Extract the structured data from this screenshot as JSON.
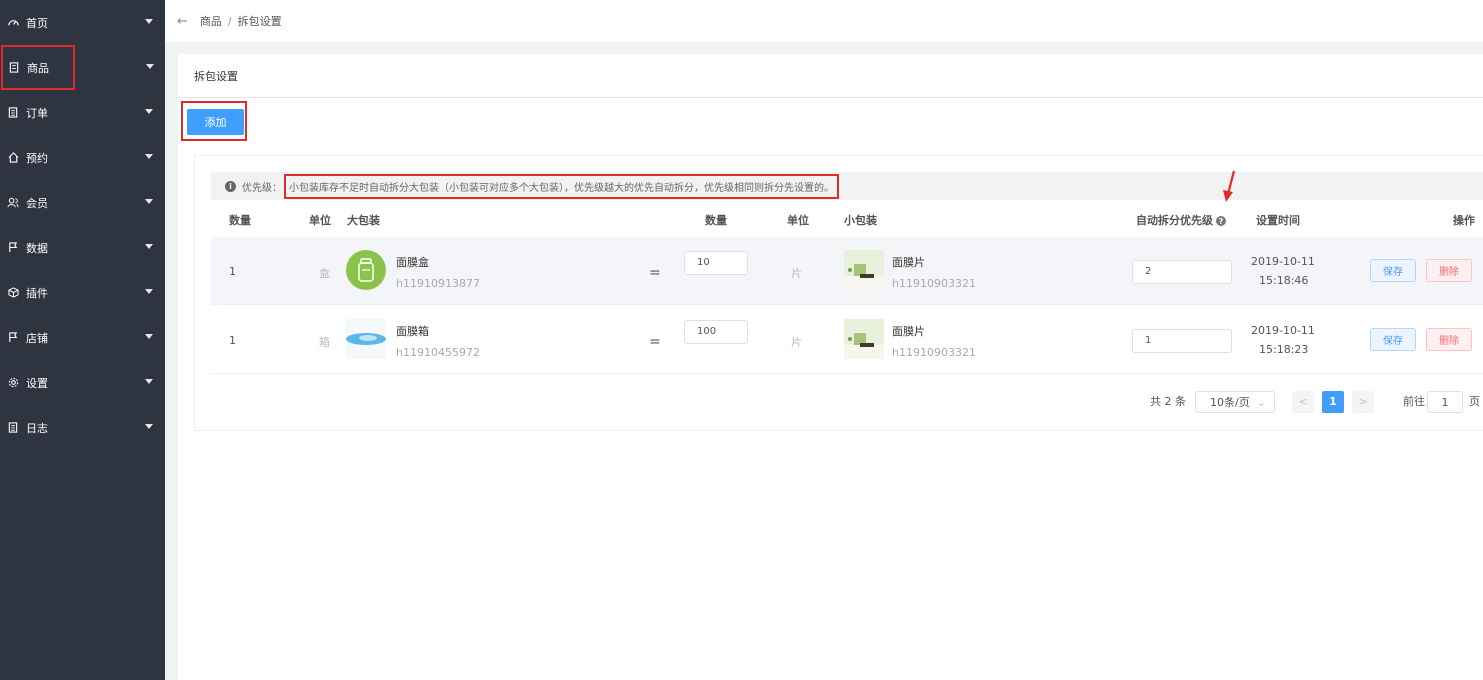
{
  "sidebar": {
    "items": [
      {
        "label": "首页",
        "icon": "dashboard-icon"
      },
      {
        "label": "商品",
        "icon": "document-icon"
      },
      {
        "label": "订单",
        "icon": "list-icon"
      },
      {
        "label": "预约",
        "icon": "home-icon"
      },
      {
        "label": "会员",
        "icon": "users-icon"
      },
      {
        "label": "数据",
        "icon": "flag-icon"
      },
      {
        "label": "插件",
        "icon": "cube-icon"
      },
      {
        "label": "店铺",
        "icon": "flag-icon"
      },
      {
        "label": "设置",
        "icon": "gear-icon"
      },
      {
        "label": "日志",
        "icon": "list-icon"
      }
    ]
  },
  "breadcrumb": {
    "back_icon": "←",
    "level1": "商品",
    "separator": "/",
    "level2": "拆包设置"
  },
  "panel": {
    "title": "拆包设置",
    "add_label": "添加"
  },
  "tip": {
    "label": "优先级：",
    "text": "小包装库存不足时自动拆分大包装（小包装可对应多个大包装），优先级越大的优先自动拆分，优先级相同则拆分先设置的。"
  },
  "table": {
    "headers": {
      "qty": "数量",
      "unit": "单位",
      "big": "大包装",
      "qty2": "数量",
      "unit2": "单位",
      "small": "小包装",
      "priority": "自动拆分优先级",
      "time": "设置时间",
      "ops": "操作"
    },
    "rows": [
      {
        "qty": "1",
        "unit": "盒",
        "big_name": "面膜盒",
        "big_code": "h11910913877",
        "eq": "=",
        "qty2": "10",
        "unit2": "片",
        "small_name": "面膜片",
        "small_code": "h11910903321",
        "priority": "2",
        "date": "2019-10-11",
        "time": "15:18:46",
        "save": "保存",
        "del": "删除"
      },
      {
        "qty": "1",
        "unit": "箱",
        "big_name": "面膜箱",
        "big_code": "h11910455972",
        "eq": "=",
        "qty2": "100",
        "unit2": "片",
        "small_name": "面膜片",
        "small_code": "h11910903321",
        "priority": "1",
        "date": "2019-10-11",
        "time": "15:18:23",
        "save": "保存",
        "del": "删除"
      }
    ]
  },
  "pagination": {
    "total": "共 2 条",
    "page_size": "10条/页",
    "prev": "<",
    "current": "1",
    "next": ">",
    "goto_prefix": "前往",
    "goto_value": "1",
    "goto_suffix": "页"
  },
  "colors": {
    "sidebar_bg": "#2f3441",
    "primary": "#409eff",
    "danger": "#f56c6c",
    "annotation": "#e02b2b"
  }
}
